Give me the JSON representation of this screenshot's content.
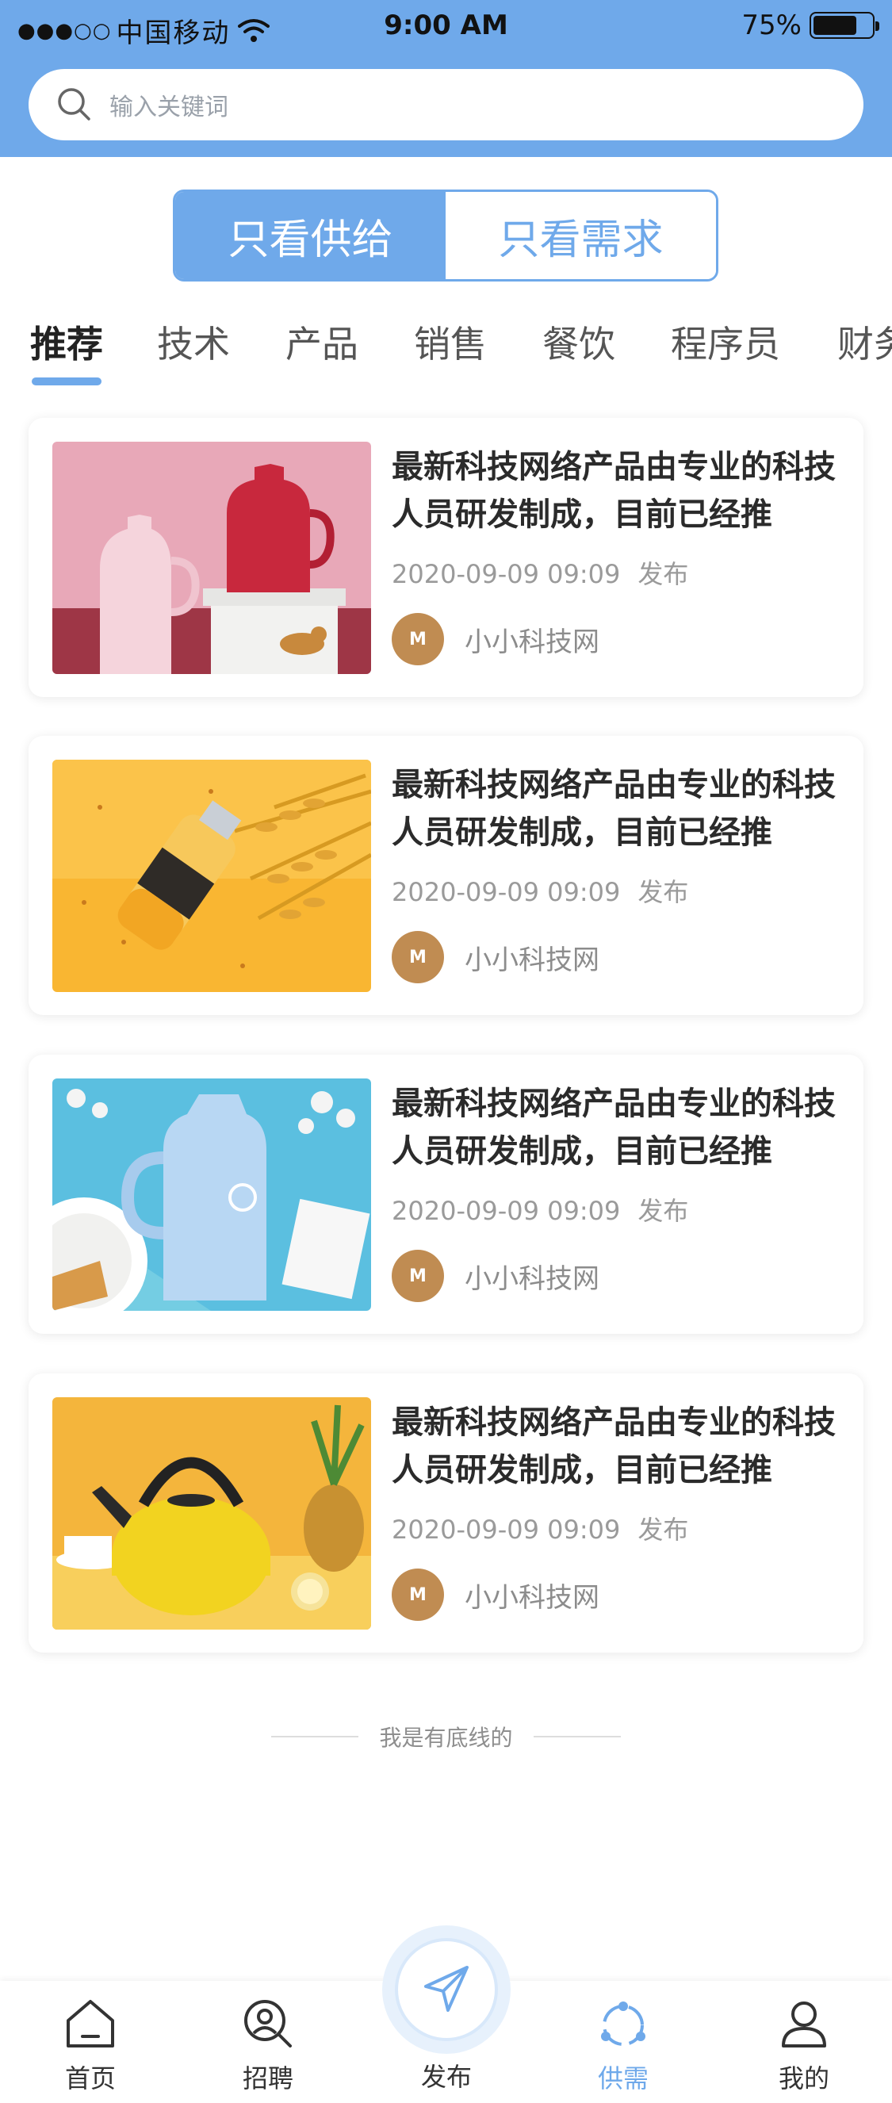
{
  "status_bar": {
    "signal_dots": "●●●○○",
    "carrier": "中国移动",
    "time": "9:00 AM",
    "battery": "75%",
    "battery_level": 0.75
  },
  "search": {
    "placeholder": "输入关键词"
  },
  "toggle": {
    "supply": "只看供给",
    "demand": "只看需求",
    "selected": "supply"
  },
  "tabs": [
    "推荐",
    "技术",
    "产品",
    "销售",
    "餐饮",
    "程序员",
    "财务"
  ],
  "active_tab": 0,
  "listings": [
    {
      "image": "pink-and-red-thermos-jugs",
      "title": "最新科技网络产品由专业的科技人员研发制成，目前已经推",
      "date": "2020-09-09 09:09",
      "publish": "发布",
      "author": "小小科技网"
    },
    {
      "image": "juice-bottle-with-wheat",
      "title": "最新科技网络产品由专业的科技人员研发制成，目前已经推",
      "date": "2020-09-09 09:09",
      "publish": "发布",
      "author": "小小科技网"
    },
    {
      "image": "blue-thermos-jug-on-table",
      "title": "最新科技网络产品由专业的科技人员研发制成，目前已经推",
      "date": "2020-09-09 09:09",
      "publish": "发布",
      "author": "小小科技网"
    },
    {
      "image": "yellow-kettle-with-pineapple",
      "title": "最新科技网络产品由专业的科技人员研发制成，目前已经推",
      "date": "2020-09-09 09:09",
      "publish": "发布",
      "author": "小小科技网"
    }
  ],
  "end_of_list": "我是有底线的",
  "bottom_nav": [
    {
      "label": "首页",
      "icon": "home-icon"
    },
    {
      "label": "招聘",
      "icon": "search-person-icon"
    },
    {
      "label": "发布",
      "icon": "send-icon"
    },
    {
      "label": "供需",
      "icon": "supply-demand-icon"
    },
    {
      "label": "我的",
      "icon": "profile-icon"
    }
  ],
  "active_nav": 3,
  "colors": {
    "accent": "#6fa9ea",
    "avatar": "#c08c52"
  }
}
